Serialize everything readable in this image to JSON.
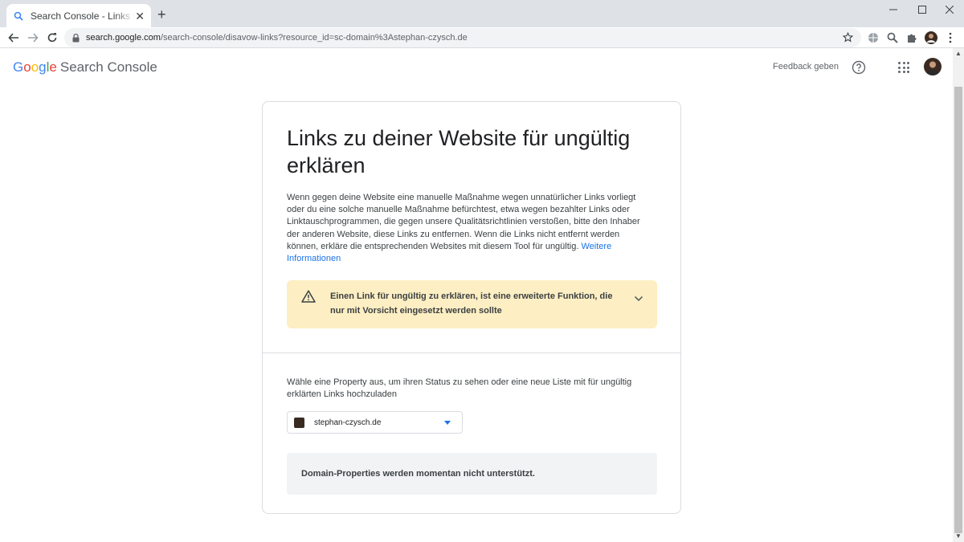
{
  "browser": {
    "tab_title": "Search Console - Links für ungültig erklären",
    "url_host": "search.google.com",
    "url_path": "/search-console/disavow-links?resource_id=sc-domain%3Astephan-czysch.de",
    "new_tab_symbol": "+",
    "close_symbol": "✕",
    "icons": [
      "back-icon",
      "forward-icon",
      "reload-icon",
      "lock-icon",
      "star-icon",
      "extension-icon",
      "profile-icon",
      "menu-icon"
    ]
  },
  "app": {
    "logo_google": [
      "G",
      "o",
      "o",
      "g",
      "l",
      "e"
    ],
    "logo_colors": [
      "#4285F4",
      "#EA4335",
      "#FBBC05",
      "#4285F4",
      "#34A853",
      "#EA4335"
    ],
    "product_name": "Search Console",
    "feedback_label": "Feedback geben"
  },
  "card": {
    "title": "Links zu deiner Website für ungültig erklären",
    "intro_text": "Wenn gegen deine Website eine manuelle Maßnahme wegen unnatürlicher Links vorliegt oder du eine solche manuelle Maßnahme befürchtest, etwa wegen bezahlter Links oder Linktauschprogrammen, die gegen unsere Qualitätsrichtlinien verstoßen, bitte den Inhaber der anderen Website, diese Links zu entfernen. Wenn die Links nicht entfernt werden können, erkläre die entsprechenden Websites mit diesem Tool für ungültig. ",
    "more_info_link": "Weitere Informationen",
    "warning_text": "Einen Link für ungültig zu erklären, ist eine erweiterte Funktion, die nur mit Vorsicht eingesetzt werden sollte",
    "choose_text": "Wähle eine Property aus, um ihren Status zu sehen oder eine neue Liste mit für ungültig erklärten Links hochzuladen",
    "property_selected": "stephan-czysch.de",
    "notice_text": "Domain-Properties werden momentan nicht unterstützt."
  },
  "colors": {
    "warning_bg": "#fdefc3",
    "notice_bg": "#f1f3f4",
    "link": "#1a73e8"
  }
}
